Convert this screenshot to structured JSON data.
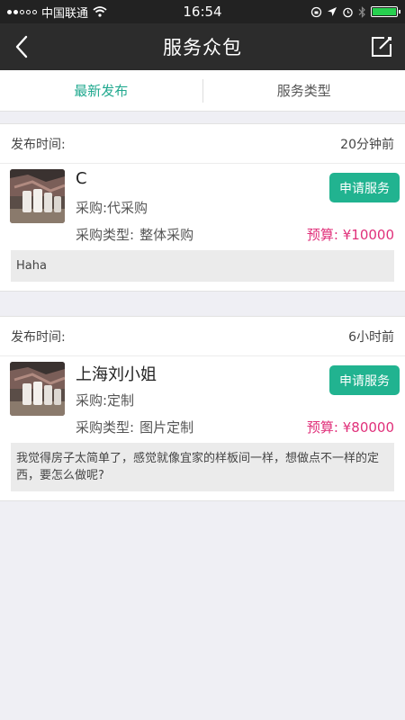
{
  "status_bar": {
    "carrier": "中国联通",
    "time": "16:54"
  },
  "nav": {
    "title": "服务众包"
  },
  "tabs": [
    {
      "label": "最新发布",
      "active": true
    },
    {
      "label": "服务类型",
      "active": false
    }
  ],
  "colors": {
    "accent": "#21a98f",
    "button": "#21b390",
    "budget": "#e0307a",
    "nav_bg": "#2c2c2c"
  },
  "posts": [
    {
      "time_label": "发布时间:",
      "time_value": "20分钟前",
      "name": "C",
      "purchase": "采购:代采购",
      "type_label": "采购类型:",
      "type_value": "整体采购",
      "budget": "预算: ¥10000",
      "button_label": "申请服务",
      "description": "Haha"
    },
    {
      "time_label": "发布时间:",
      "time_value": "6小时前",
      "name": "上海刘小姐",
      "purchase": "采购:定制",
      "type_label": "采购类型:",
      "type_value": "图片定制",
      "budget": "预算: ¥80000",
      "button_label": "申请服务",
      "description": "我觉得房子太简单了，感觉就像宜家的样板间一样，想做点不一样的定西，要怎么做呢?"
    }
  ]
}
